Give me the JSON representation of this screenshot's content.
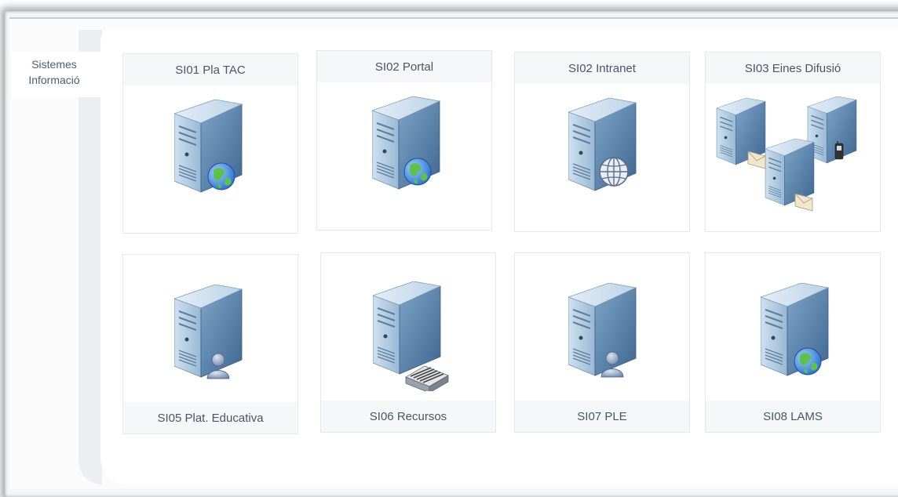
{
  "side_label": "Sistemes Informació",
  "cards": [
    {
      "label": "SI01 Pla TAC",
      "icon": "server-globe-icon"
    },
    {
      "label": "SI02 Portal",
      "icon": "server-globe-icon"
    },
    {
      "label": "SI02 Intranet",
      "icon": "server-web-icon"
    },
    {
      "label": "SI03 Eines Difusió",
      "icon": "server-network-mail-mobile-icon"
    },
    {
      "label": "SI05 Plat. Educativa",
      "icon": "server-user-icon"
    },
    {
      "label": "SI06 Recursos",
      "icon": "server-storage-icon"
    },
    {
      "label": "SI07 PLE",
      "icon": "server-user-icon"
    },
    {
      "label": "SI08 LAMS",
      "icon": "server-globe-icon"
    }
  ],
  "colors": {
    "server_front": "#a9c6df",
    "server_side": "#5f86ad",
    "globe": "#3f8fe0",
    "land": "#5cc24a",
    "label_text": "#48556a"
  }
}
